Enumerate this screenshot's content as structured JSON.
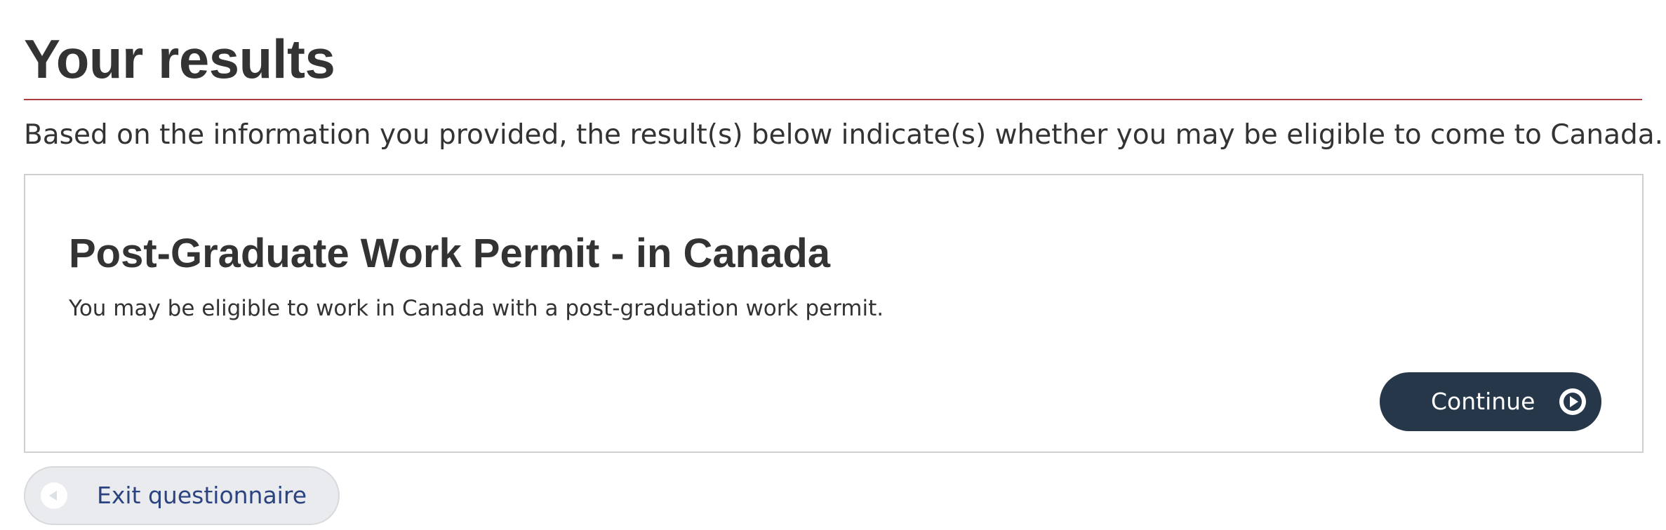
{
  "header": {
    "title": "Your results"
  },
  "intro": {
    "text": "Based on the information you provided, the result(s) below indicate(s) whether you may be eligible to come to Canada."
  },
  "result": {
    "title": "Post-Graduate Work Permit - in Canada",
    "description": "You may be eligible to work in Canada with a post-graduation work permit.",
    "continue_label": "Continue",
    "continue_icon": "play-circle-icon"
  },
  "footer": {
    "exit_label": "Exit questionnaire",
    "exit_icon": "back-circle-icon"
  },
  "colors": {
    "title_rule": "#af3c43",
    "primary_button": "#26374a",
    "secondary_button": "#e9ebee",
    "link_text": "#2b4380"
  }
}
